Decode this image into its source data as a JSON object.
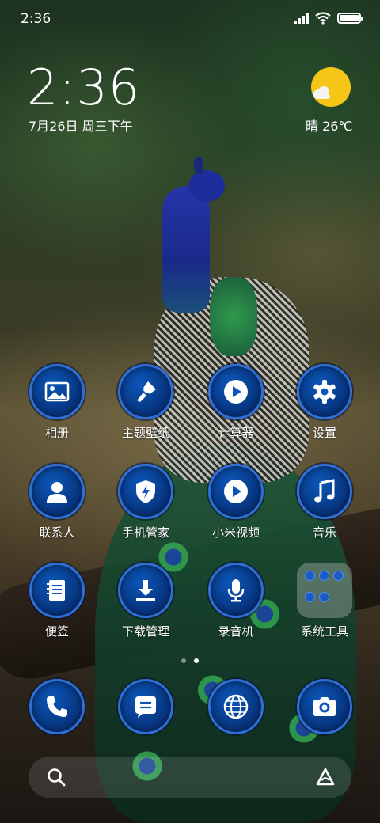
{
  "status_bar": {
    "time": "2:36",
    "icons": [
      "signal-icon",
      "wifi-icon",
      "battery-icon"
    ]
  },
  "clock_widget": {
    "time": "2:36",
    "date": "7月26日 周三下午"
  },
  "weather_widget": {
    "icon": "sun-cloud-icon",
    "text": "晴 26℃"
  },
  "apps": {
    "gallery": "相册",
    "themes": "主题壁纸",
    "calculator": "计算器",
    "settings": "设置",
    "contacts": "联系人",
    "security": "手机管家",
    "mi_video": "小米视频",
    "music": "音乐",
    "notes": "便签",
    "downloads": "下载管理",
    "recorder": "录音机",
    "tools_folder": "系统工具"
  },
  "dock": [
    "phone-icon",
    "messages-icon",
    "browser-icon",
    "camera-icon"
  ],
  "colors": {
    "icon_ring": "#2e6fd6",
    "icon_fill": "#0b56b8",
    "weather_sun": "#f5c518"
  }
}
